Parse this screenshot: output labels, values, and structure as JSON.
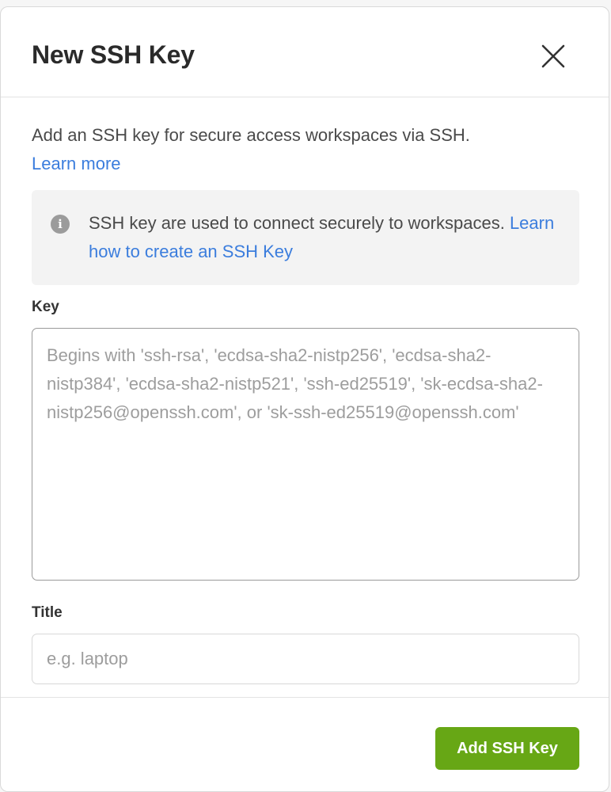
{
  "dialog": {
    "title": "New SSH Key",
    "close_icon": "close-icon",
    "intro_text": "Add an SSH key for secure access workspaces via SSH.",
    "intro_link": "Learn more",
    "info": {
      "icon": "info-icon",
      "icon_glyph": "i",
      "text": "SSH key are used to connect securely to workspaces.",
      "link": "Learn how to create an SSH Key"
    },
    "key_field": {
      "label": "Key",
      "value": "",
      "placeholder": "Begins with 'ssh-rsa', 'ecdsa-sha2-nistp256', 'ecdsa-sha2-nistp384', 'ecdsa-sha2-nistp521', 'ssh-ed25519', 'sk-ecdsa-sha2-nistp256@openssh.com', or 'sk-ssh-ed25519@openssh.com'"
    },
    "title_field": {
      "label": "Title",
      "value": "",
      "placeholder": "e.g. laptop"
    },
    "submit_label": "Add SSH Key"
  },
  "colors": {
    "link": "#3b7ddd",
    "primary_button": "#67a715",
    "info_background": "#f3f3f3"
  }
}
